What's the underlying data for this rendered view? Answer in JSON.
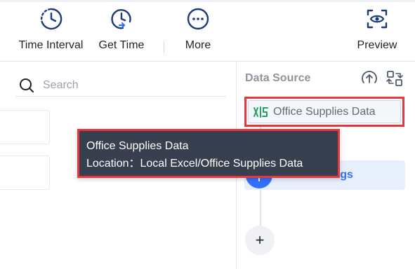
{
  "toolbar": {
    "buttons": [
      {
        "label": "Time Interval",
        "icon": "time-interval-icon"
      },
      {
        "label": "Get Time",
        "icon": "get-time-icon"
      },
      {
        "label": "More",
        "icon": "more-icon"
      },
      {
        "label": "Preview",
        "icon": "preview-icon"
      }
    ]
  },
  "left_panel": {
    "search": {
      "placeholder": "Search",
      "value": ""
    }
  },
  "right_panel": {
    "title": "Data Source",
    "data_source": {
      "name": "Office Supplies Data",
      "icon": "excel-file-icon"
    },
    "field_settings_label": "Field Settings",
    "add_label": "+"
  },
  "tooltip": {
    "name": "Office Supplies Data",
    "location_label": "Location：",
    "location_value": "Local Excel/Office Supplies Data"
  },
  "colors": {
    "accent": "#3370ff",
    "highlight_border": "#e0393e",
    "tooltip_bg": "#38404f",
    "excel_green": "#21a366"
  }
}
